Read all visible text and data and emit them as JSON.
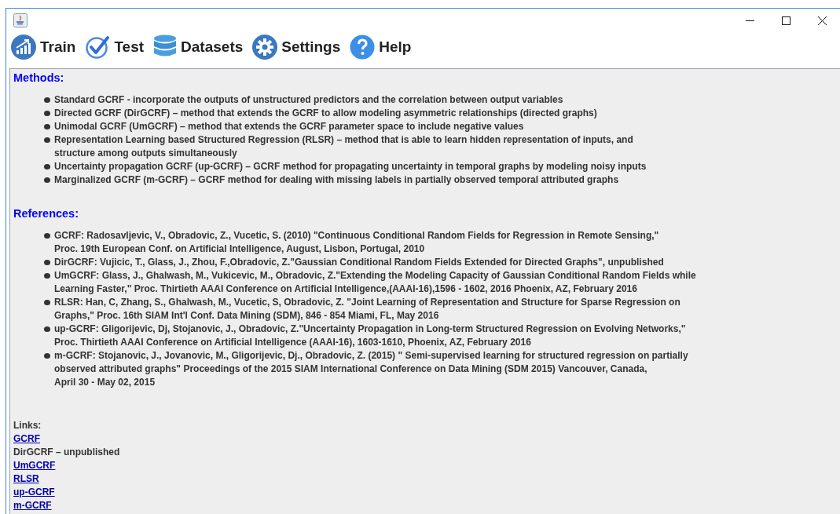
{
  "toolbar": [
    {
      "label": "Train"
    },
    {
      "label": "Test"
    },
    {
      "label": "Datasets"
    },
    {
      "label": "Settings"
    },
    {
      "label": "Help"
    }
  ],
  "methods": {
    "heading": "Methods:",
    "items": [
      {
        "lines": [
          "Standard GCRF - incorporate the outputs of unstructured predictors and the correlation between output variables"
        ]
      },
      {
        "lines": [
          "Directed GCRF (DirGCRF) – method that extends the GCRF to allow modeling asymmetric relationships (directed graphs)"
        ]
      },
      {
        "lines": [
          "Unimodal GCRF (UmGCRF) – method that extends the GCRF parameter space to include negative values"
        ]
      },
      {
        "lines": [
          "Representation Learning based Structured Regression (RLSR) – method that is able to learn hidden representation of inputs, and",
          "structure among outputs simultaneously"
        ]
      },
      {
        "lines": [
          "Uncertainty propagation GCRF (up-GCRF) – GCRF method for propagating uncertainty in temporal graphs by modeling noisy inputs"
        ]
      },
      {
        "lines": [
          "Marginalized GCRF (m-GCRF) – GCRF method for dealing with missing labels in partially observed temporal attributed graphs"
        ]
      }
    ]
  },
  "references": {
    "heading": "References:",
    "items": [
      {
        "lines": [
          "GCRF: Radosavljevic, V., Obradovic, Z., Vucetic, S. (2010) \"Continuous Conditional Random Fields for Regression in Remote Sensing,\"",
          "Proc. 19th European Conf. on Artificial Intelligence, August, Lisbon, Portugal, 2010"
        ]
      },
      {
        "lines": [
          "DirGCRF: Vujicic, T., Glass, J., Zhou, F.,Obradovic, Z.\"Gaussian Conditional Random Fields Extended for Directed Graphs\", unpublished"
        ]
      },
      {
        "lines": [
          "UmGCRF: Glass, J., Ghalwash, M., Vukicevic, M., Obradovic, Z.\"Extending the Modeling Capacity of Gaussian Conditional Random Fields while",
          "Learning Faster,\" Proc. Thirtieth AAAI Conference on Artificial Intelligence,(AAAI-16),1596 - 1602, 2016 Phoenix, AZ, February 2016"
        ]
      },
      {
        "lines": [
          "RLSR: Han, C, Zhang, S., Ghalwash, M., Vucetic, S, Obradovic, Z. \"Joint Learning of Representation and Structure for Sparse Regression on",
          "Graphs,\" Proc. 16th SIAM Int'l Conf. Data Mining (SDM), 846 - 854 Miami, FL, May 2016"
        ]
      },
      {
        "lines": [
          "up-GCRF: Gligorijevic, Dj, Stojanovic, J., Obradovic, Z.\"Uncertainty Propagation in Long-term Structured Regression on Evolving Networks,\"",
          "Proc. Thirtieth AAAI Conference on Artificial Intelligence (AAAI-16), 1603-1610, Phoenix, AZ, February 2016"
        ]
      },
      {
        "lines": [
          "m-GCRF: Stojanovic, J., Jovanovic, M., Gligorijevic, Dj., Obradovic, Z. (2015) \" Semi-supervised learning for structured regression on partially",
          "observed attributed graphs\" Proceedings of the 2015 SIAM International Conference on Data Mining (SDM 2015) Vancouver, Canada,",
          "April 30 - May 02, 2015"
        ]
      }
    ]
  },
  "links": {
    "heading": "Links:",
    "items": [
      {
        "kind": "link",
        "text": "GCRF"
      },
      {
        "kind": "text",
        "text": "DirGCRF – unpublished"
      },
      {
        "kind": "link",
        "text": "UmGCRF"
      },
      {
        "kind": "link",
        "text": "RLSR"
      },
      {
        "kind": "link",
        "text": "up-GCRF"
      },
      {
        "kind": "link",
        "text": "m-GCRF"
      }
    ]
  }
}
